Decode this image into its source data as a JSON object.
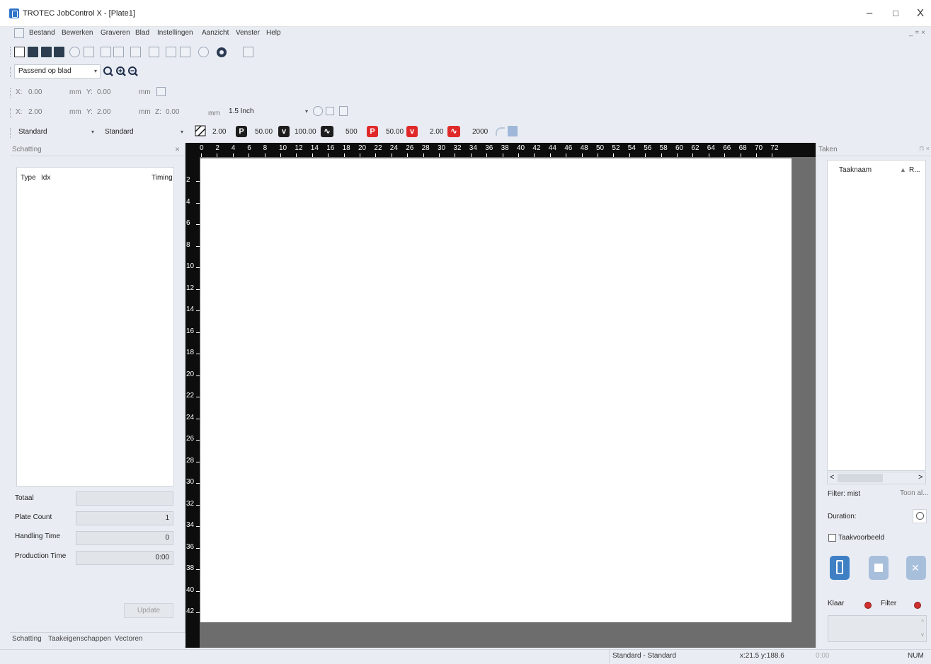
{
  "window": {
    "title": "TROTEC JobControl X - [Plate1]",
    "min": "–",
    "max": "□",
    "close": "X"
  },
  "menu": [
    "Bestand",
    "Bewerken",
    "Graveren",
    "Blad",
    "Instellingen",
    "Aanzicht",
    "Venster",
    "Help"
  ],
  "menu_right": "_ = ×",
  "zoom": {
    "value": "Passend op blad"
  },
  "pos1": {
    "x_label": "X:",
    "x": "0.00",
    "x_unit": "mm",
    "y_label": "Y:",
    "y": "0.00",
    "y_unit": "mm"
  },
  "pos2": {
    "x_label": "X:",
    "x": "2.00",
    "x_unit": "mm",
    "y_label": "Y:",
    "y": "2.00",
    "y_unit": "mm",
    "z_label": "Z:",
    "z": "0.00",
    "z_unit": "mm",
    "lens": "1.5 Inch"
  },
  "material": {
    "left": "Standard",
    "right": "Standard"
  },
  "laser_params": {
    "v1": "2.00",
    "p1_badge": "P",
    "v2": "50.00",
    "v1_badge": "v",
    "v3": "100.00",
    "f1": "500",
    "p2_badge": "P",
    "v4": "50.00",
    "v2_badge": "v",
    "v5": "2.00",
    "f2": "2000"
  },
  "left_panel": {
    "title": "Schatting",
    "close": "×",
    "col_type": "Type",
    "col_idx": "Idx",
    "col_timing": "Timing",
    "totaal_label": "Totaal",
    "totaal": "",
    "plate_count_label": "Plate Count",
    "plate_count": "1",
    "handling_label": "Handling Time",
    "handling": "0",
    "production_label": "Production Time",
    "production": "0:00",
    "update": "Update",
    "tabs": [
      "Schatting",
      "Taakeigenschappen",
      "Vectoren"
    ]
  },
  "rulers": {
    "top": [
      "0",
      "2",
      "4",
      "6",
      "8",
      "10",
      "12",
      "14",
      "16",
      "18",
      "20",
      "22",
      "24",
      "26",
      "28",
      "30",
      "32",
      "34",
      "36",
      "38",
      "40",
      "42",
      "44",
      "46",
      "48",
      "50",
      "52",
      "54",
      "56",
      "58",
      "60",
      "62",
      "64",
      "66",
      "68",
      "70",
      "72"
    ],
    "left": [
      "2",
      "4",
      "6",
      "8",
      "10",
      "12",
      "14",
      "16",
      "18",
      "20",
      "22",
      "24",
      "26",
      "28",
      "30",
      "32",
      "34",
      "36",
      "38",
      "40",
      "42"
    ]
  },
  "right_panel": {
    "title": "Taken",
    "pin": "⊓ ×",
    "col_name": "Taaknaam",
    "col_r": "R...",
    "scroll_left": "<",
    "scroll_right": ">",
    "filter_label": "Filter: mist",
    "toon_all": "Toon al...",
    "duration_label": "Duration:",
    "preview_label": "Taakvoorbeeld",
    "klaar": "Klaar",
    "filter": "Filter"
  },
  "status": {
    "material": "Standard - Standard",
    "coords": "x:21.5  y:188.6",
    "time": "0:00",
    "num": "NUM"
  }
}
